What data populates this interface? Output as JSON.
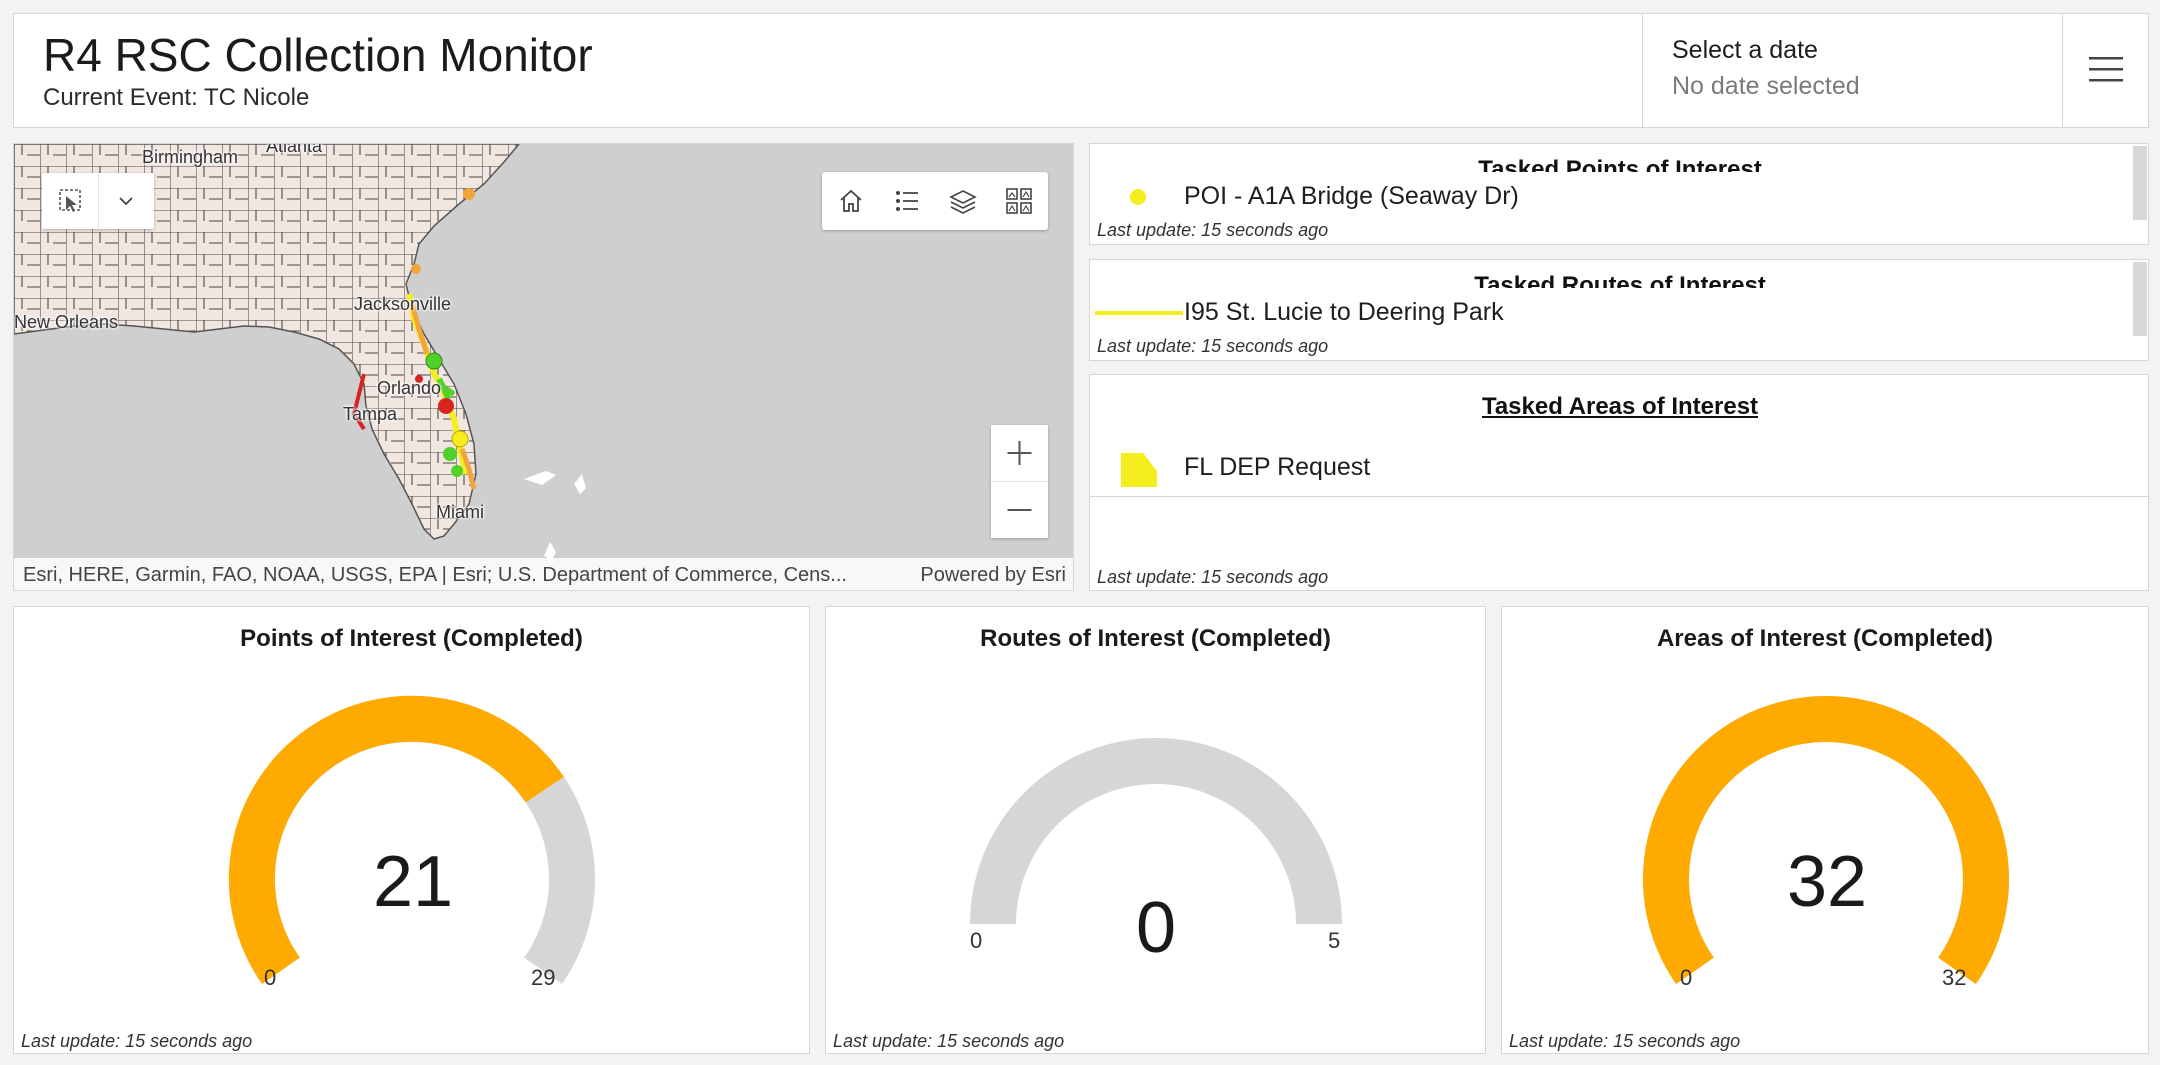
{
  "header": {
    "title": "R4 RSC Collection Monitor",
    "subtitle": "Current Event: TC Nicole",
    "date_label": "Select a date",
    "date_value": "No date selected"
  },
  "map": {
    "labels": {
      "birmingham": "Birmingham",
      "atlanta": "Atlanta",
      "new_orleans": "New Orleans",
      "jacksonville": "Jacksonville",
      "orlando": "Orlando",
      "tampa": "Tampa",
      "miami": "Miami"
    },
    "attribution": "Esri, HERE, Garmin, FAO, NOAA, USGS, EPA | Esri; U.S. Department of Commerce, Cens...",
    "powered_by": "Powered by Esri"
  },
  "lists": {
    "points": {
      "title": "Tasked Points of Interest",
      "items": [
        "POI - A1A Bridge (Seaway Dr)"
      ],
      "last_update": "Last update: 15 seconds ago"
    },
    "routes": {
      "title": "Tasked Routes of Interest",
      "items": [
        "I95 St. Lucie to Deering Park"
      ],
      "last_update": "Last update: 15 seconds ago"
    },
    "areas": {
      "title": "Tasked Areas of Interest",
      "items": [
        "FL DEP Request"
      ],
      "last_update": "Last update: 15 seconds ago"
    }
  },
  "gauges": [
    {
      "title": "Points of Interest (Completed)",
      "value": 21,
      "min": 0,
      "max": 29,
      "last_update": "Last update: 15 seconds ago"
    },
    {
      "title": "Routes of Interest (Completed)",
      "value": 0,
      "min": 0,
      "max": 5,
      "last_update": "Last update: 15 seconds ago"
    },
    {
      "title": "Areas of Interest (Completed)",
      "value": 32,
      "min": 0,
      "max": 32,
      "last_update": "Last update: 15 seconds ago"
    }
  ],
  "colors": {
    "gauge_fill": "#ffaa00",
    "gauge_track": "#d6d6d6",
    "poi_marker": "#f5ee1f",
    "route_line": "#f5ee1f",
    "area_fill": "#f5ee1f",
    "status_green": "#4fd12a",
    "status_red": "#d8231f",
    "status_orange": "#f3a43a"
  },
  "icons": {
    "menu": "hamburger-menu-icon",
    "select": "map-select-icon",
    "dropdown": "chevron-down-icon",
    "home": "home-icon",
    "legend": "legend-list-icon",
    "layers": "layers-icon",
    "basemap": "basemap-gallery-icon",
    "zoom_in": "plus-icon",
    "zoom_out": "minus-icon"
  }
}
